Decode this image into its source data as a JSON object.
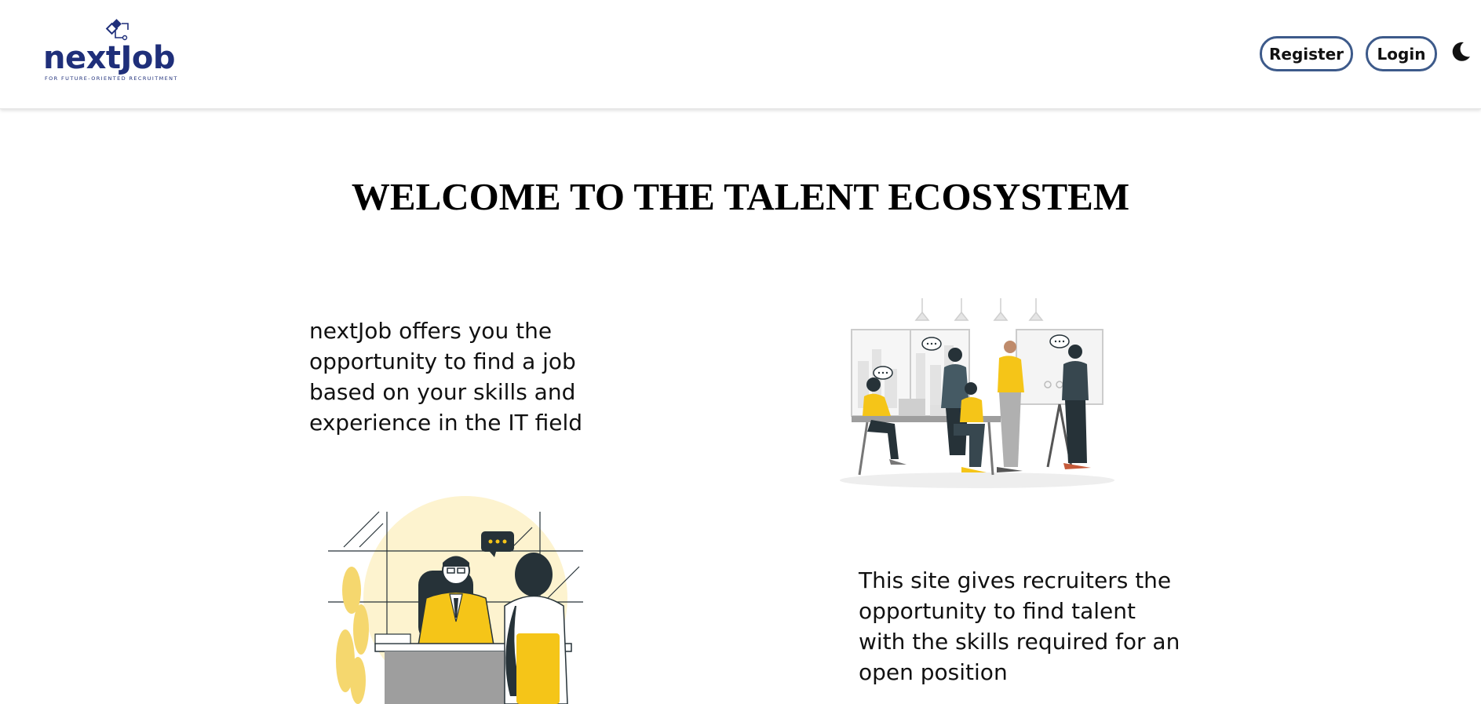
{
  "header": {
    "logo": {
      "name": "nextJob",
      "tagline": "FOR   FUTURE-ORIENTED RECRUITMENT"
    },
    "register_label": "Register",
    "login_label": "Login",
    "theme_icon": "moon-icon"
  },
  "main": {
    "title": "WELCOME TO THE TALENT ECOSYSTEM",
    "section1_text": "nextJob offers you the opportunity to find a job based on your skills and experience in the IT field",
    "section2_text": "This site gives recruiters the opportunity to find talent with the skills required for an open position"
  },
  "colors": {
    "brand": "#1f2f7a",
    "button_border": "#3d5a8a",
    "illustration_accent": "#f5c518",
    "illustration_dark": "#263238"
  }
}
